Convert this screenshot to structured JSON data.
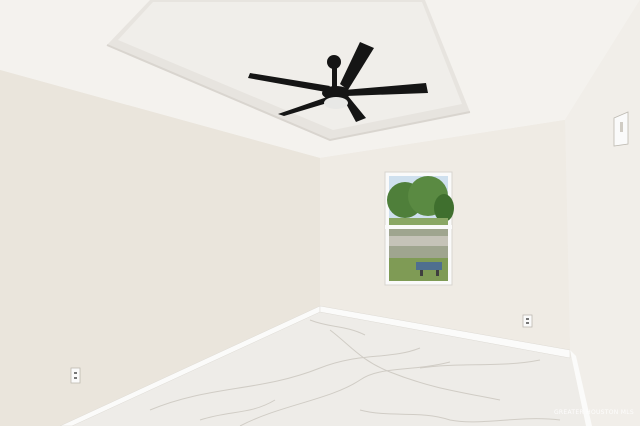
{
  "scene": {
    "description_type": "empty-room-photo",
    "watermark_text": "GREATER HOUSTON MLS",
    "colors": {
      "wall_left": "#eae5dc",
      "wall_back": "#efebe4",
      "wall_right": "#f1eee9",
      "ceiling": "#f4f2ee",
      "tray_ceiling": "#f0eeea",
      "baseboard": "#fbfbfa",
      "floor": "#eeece8",
      "marble_vein": "#c9c5bd",
      "fan": "#151515",
      "window_frame": "#fafafa",
      "sky": "#cfe0ee",
      "trees": "#4f7f3a",
      "grass": "#7f9b55"
    },
    "icons": [
      "ceiling-fan-icon",
      "electrical-outlet-icon",
      "light-switch-icon"
    ]
  }
}
